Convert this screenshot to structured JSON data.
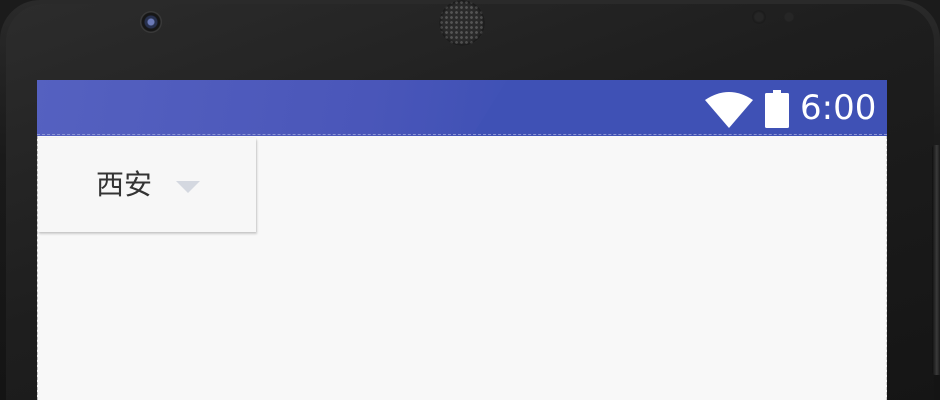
{
  "device": {
    "bezel_color": "#1a1a1a"
  },
  "status_bar": {
    "background": "#3f51b5",
    "time": "6:00",
    "icons": [
      "wifi-icon",
      "battery-icon"
    ]
  },
  "spinner": {
    "selected_value": "西安",
    "arrow_icon": "dropdown-triangle-icon",
    "arrow_color": "#d4d8e0"
  }
}
